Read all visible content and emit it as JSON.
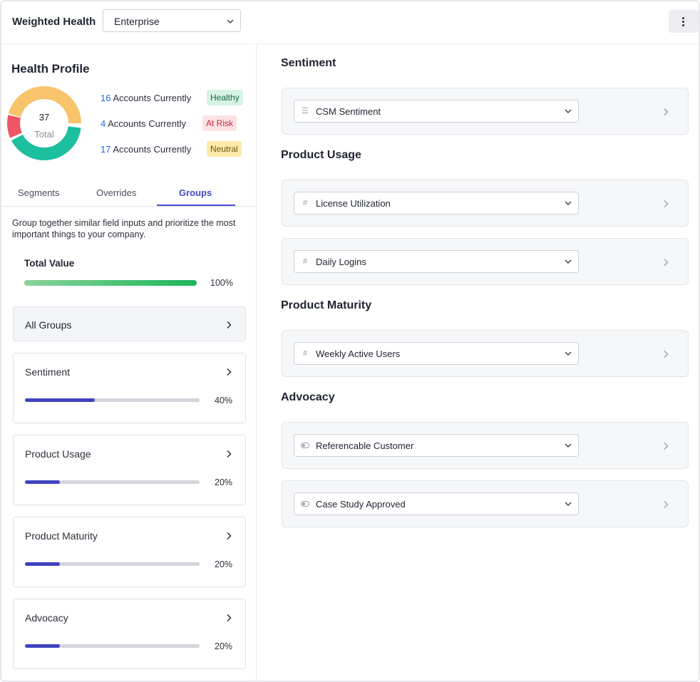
{
  "header": {
    "title": "Weighted Health",
    "profile_select": "Enterprise"
  },
  "health_profile": {
    "title": "Health Profile",
    "total": "37",
    "total_label": "Total",
    "rows": [
      {
        "count": "16",
        "text": "Accounts Currently",
        "badge": "Healthy"
      },
      {
        "count": "4",
        "text": "Accounts Currently",
        "badge": "At Risk"
      },
      {
        "count": "17",
        "text": "Accounts Currently",
        "badge": "Neutral"
      }
    ],
    "colors": {
      "healthy": "#1dbf9e",
      "at_risk": "#ee5565",
      "neutral": "#f7c46c"
    }
  },
  "tabs": [
    {
      "label": "Segments",
      "active": false
    },
    {
      "label": "Overrides",
      "active": false
    },
    {
      "label": "Groups",
      "active": true
    }
  ],
  "groups_panel": {
    "description": "Group together similar field inputs and prioritize the most important things to your company.",
    "total_value_label": "Total Value",
    "total_value_pct": "100%",
    "all_groups_label": "All Groups",
    "groups": [
      {
        "label": "Sentiment",
        "pct": "40%",
        "value": 0.4
      },
      {
        "label": "Product Usage",
        "pct": "20%",
        "value": 0.2
      },
      {
        "label": "Product Maturity",
        "pct": "20%",
        "value": 0.2
      },
      {
        "label": "Advocacy",
        "pct": "20%",
        "value": 0.2
      }
    ]
  },
  "sections": [
    {
      "title": "Sentiment",
      "fields": [
        {
          "icon": "list-icon",
          "label": "CSM Sentiment"
        }
      ]
    },
    {
      "title": "Product Usage",
      "fields": [
        {
          "icon": "hash-icon",
          "label": "License Utilization"
        },
        {
          "icon": "hash-icon",
          "label": "Daily Logins"
        }
      ]
    },
    {
      "title": "Product Maturity",
      "fields": [
        {
          "icon": "hash-icon",
          "label": "Weekly Active Users"
        }
      ]
    },
    {
      "title": "Advocacy",
      "fields": [
        {
          "icon": "toggle-icon",
          "label": "Referencable Customer"
        },
        {
          "icon": "toggle-icon",
          "label": "Case Study Approved"
        }
      ]
    }
  ]
}
